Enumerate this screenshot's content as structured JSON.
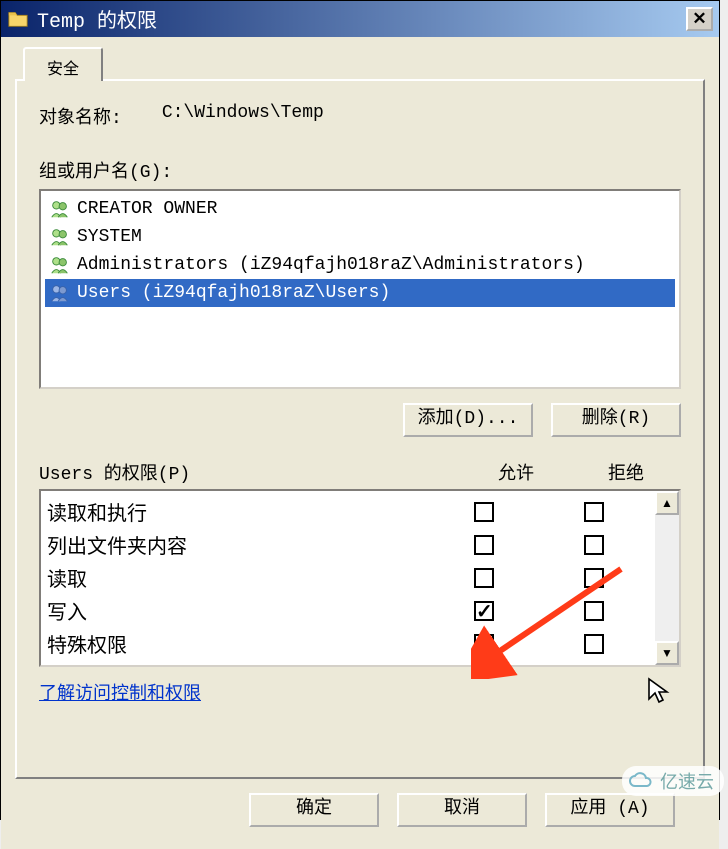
{
  "title": "Temp 的权限",
  "tab_label": "安全",
  "object_name_label": "对象名称:",
  "object_name_value": "C:\\Windows\\Temp",
  "groups_label": "组或用户名(G):",
  "users": [
    {
      "name": "CREATOR OWNER",
      "selected": false
    },
    {
      "name": "SYSTEM",
      "selected": false
    },
    {
      "name": "Administrators (iZ94qfajh018raZ\\Administrators)",
      "selected": false
    },
    {
      "name": "Users (iZ94qfajh018raZ\\Users)",
      "selected": true
    }
  ],
  "buttons": {
    "add": "添加(D)...",
    "remove": "删除(R)",
    "ok": "确定",
    "cancel": "取消",
    "apply": "应用 (A)"
  },
  "perm_list_label": "Users 的权限(P)",
  "perm_cols": {
    "allow": "允许",
    "deny": "拒绝"
  },
  "permissions": [
    {
      "name": "读取和执行",
      "allow": false,
      "deny": false
    },
    {
      "name": "列出文件夹内容",
      "allow": false,
      "deny": false
    },
    {
      "name": "读取",
      "allow": false,
      "deny": false
    },
    {
      "name": "写入",
      "allow": true,
      "deny": false
    },
    {
      "name": "特殊权限",
      "allow": false,
      "deny": false
    }
  ],
  "help_link": "了解访问控制和权限",
  "watermark": "亿速云"
}
